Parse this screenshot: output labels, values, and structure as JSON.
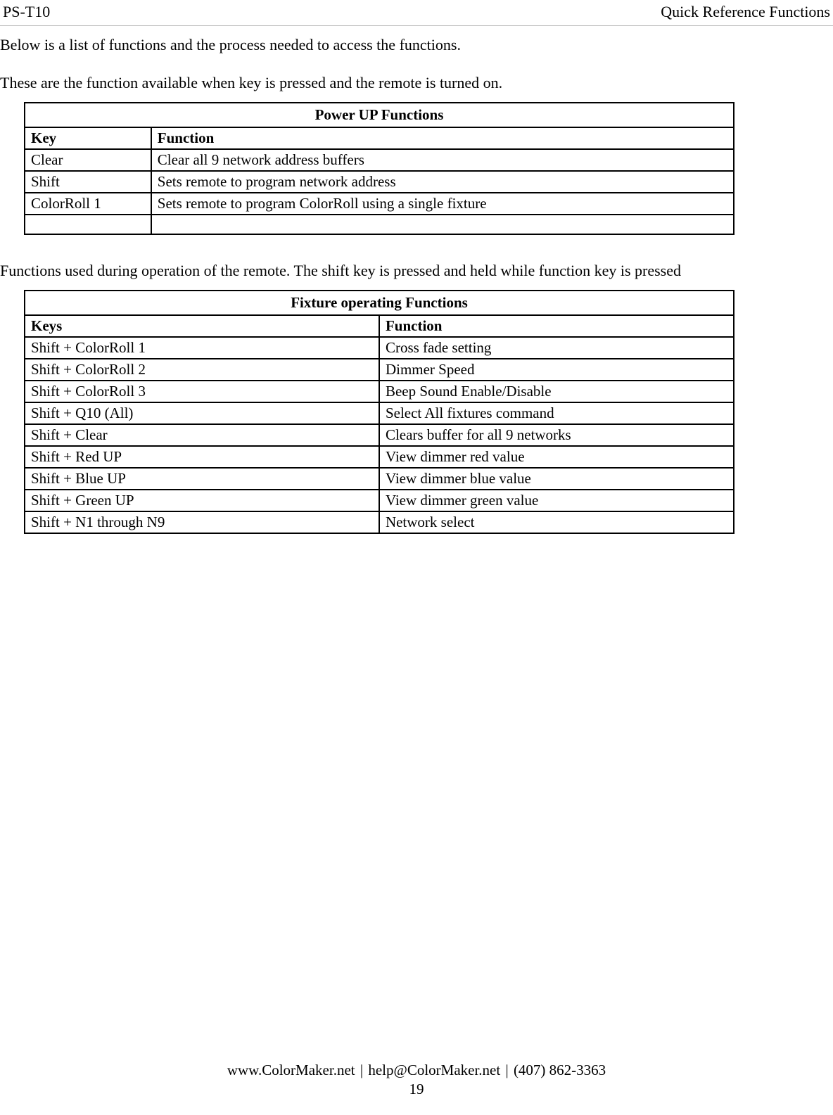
{
  "header": {
    "left": "PS-T10",
    "right": "Quick Reference Functions"
  },
  "intro": "Below is a list of functions and the process needed to access the functions.",
  "section1": {
    "lead": "These are the function available when key is pressed and the remote is turned on.",
    "title": "Power UP Functions",
    "col1": "Key",
    "col2": "Function",
    "rows": [
      {
        "key": "Clear",
        "fn": "Clear all 9 network address buffers"
      },
      {
        "key": "Shift",
        "fn": "Sets remote to program network address"
      },
      {
        "key": "ColorRoll 1",
        "fn": "Sets remote to program ColorRoll using a single fixture"
      },
      {
        "key": "",
        "fn": ""
      }
    ]
  },
  "section2": {
    "lead": "Functions used during operation of the remote. The shift key is pressed and held while function key is pressed",
    "title": "Fixture operating Functions",
    "col1": "Keys",
    "col2": "Function",
    "rows": [
      {
        "key": "Shift + ColorRoll 1",
        "fn": "Cross fade setting"
      },
      {
        "key": "Shift + ColorRoll 2",
        "fn": "Dimmer Speed"
      },
      {
        "key": "Shift + ColorRoll 3",
        "fn": "Beep Sound Enable/Disable"
      },
      {
        "key": "Shift + Q10 (All)",
        "fn": "Select All fixtures command"
      },
      {
        "key": "Shift + Clear",
        "fn": "Clears buffer for all 9 networks"
      },
      {
        "key": "Shift + Red UP",
        "fn": "View dimmer red value"
      },
      {
        "key": "Shift + Blue UP",
        "fn": "View dimmer blue value"
      },
      {
        "key": "Shift + Green UP",
        "fn": "View dimmer green value"
      },
      {
        "key": "Shift + N1 through N9",
        "fn": "Network select"
      }
    ]
  },
  "footer": {
    "site": "www.ColorMaker.net",
    "email": "help@ColorMaker.net",
    "phone": "(407) 862-3363",
    "page": "19",
    "sep": "|"
  }
}
